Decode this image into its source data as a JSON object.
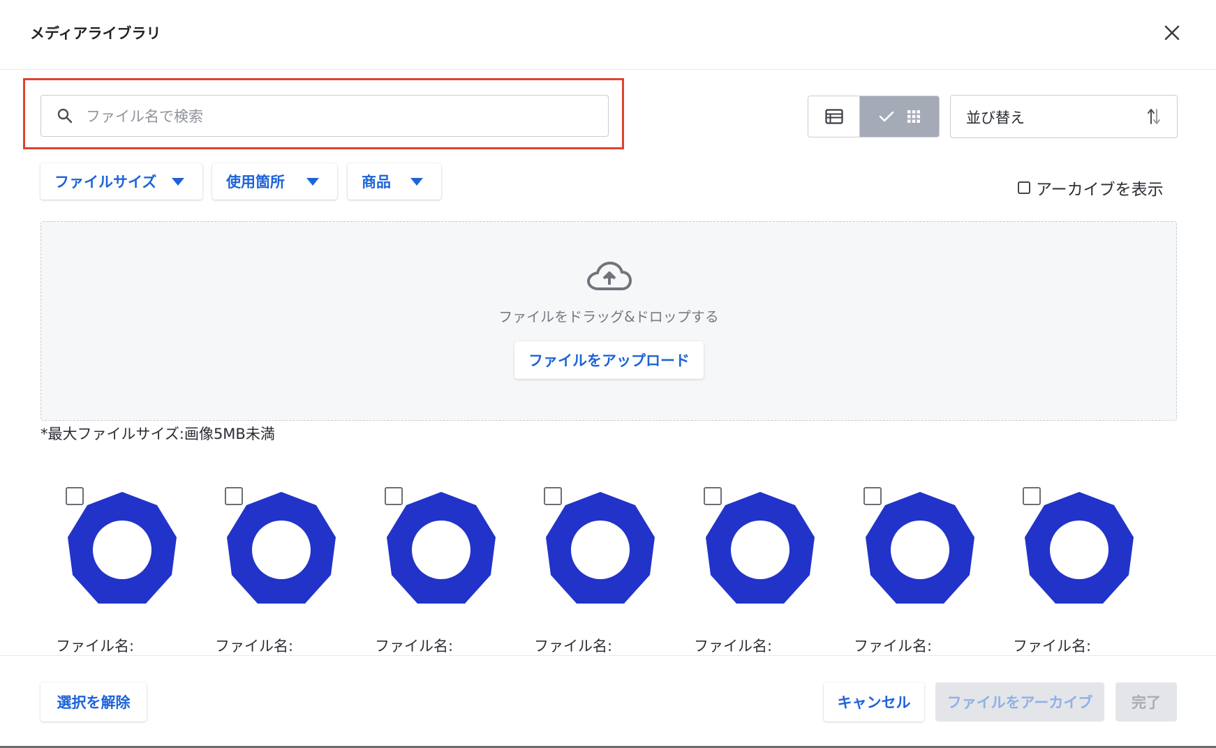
{
  "dialog": {
    "title": "メディアライブラリ"
  },
  "search": {
    "placeholder": "ファイル名で検索",
    "value": ""
  },
  "view": {
    "selected": "grid"
  },
  "sort": {
    "label": "並び替え"
  },
  "filters": [
    {
      "label": "ファイルサイズ"
    },
    {
      "label": "使用箇所"
    },
    {
      "label": "商品"
    }
  ],
  "archive": {
    "label": "アーカイブを表示",
    "checked": false
  },
  "dropzone": {
    "text": "ファイルをドラッグ&ドロップする",
    "upload_label": "ファイルをアップロード"
  },
  "size_note": "*最大ファイルサイズ:画像5MB未満",
  "files": [
    {
      "name": "ファイル名:"
    },
    {
      "name": "ファイル名:"
    },
    {
      "name": "ファイル名:"
    },
    {
      "name": "ファイル名:"
    },
    {
      "name": "ファイル名:"
    },
    {
      "name": "ファイル名:"
    },
    {
      "name": "ファイル名:"
    }
  ],
  "footer": {
    "deselect_label": "選択を解除",
    "cancel_label": "キャンセル",
    "archive_label": "ファイルをアーカイブ",
    "done_label": "完了"
  },
  "colors": {
    "accent": "#1d63d8",
    "thumbnail": "#2233c9",
    "highlight": "#e0432c"
  }
}
